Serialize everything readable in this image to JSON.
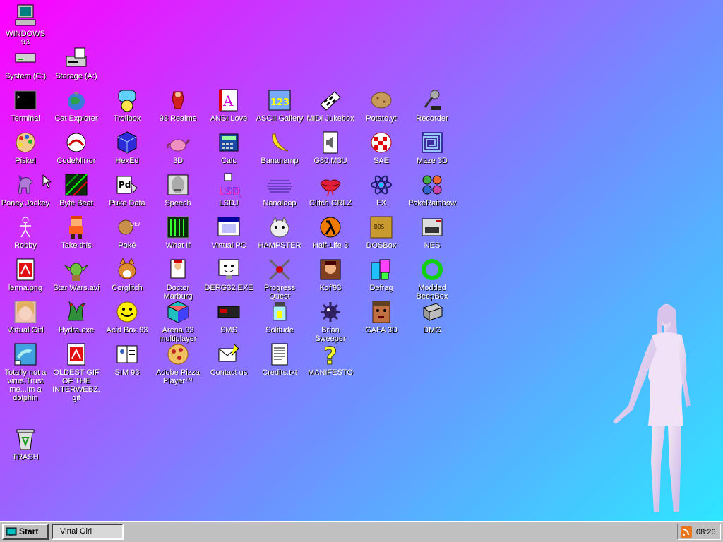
{
  "desktop": {
    "icons": [
      {
        "label": "WINDOWS 93",
        "icon": "computer-icon"
      },
      {
        "label": "System (C:)",
        "icon": "hard-drive-icon"
      },
      {
        "label": "Storage (A:)",
        "icon": "floppy-drive-icon"
      },
      {
        "label": "Terminal",
        "icon": "terminal-icon"
      },
      {
        "label": "Cat Explorer",
        "icon": "cat-globe-icon"
      },
      {
        "label": "Trollbox",
        "icon": "chat-bubble-icon"
      },
      {
        "label": "93 Realms",
        "icon": "warrior-icon"
      },
      {
        "label": "ANSI Love",
        "icon": "ansi-letter-icon"
      },
      {
        "label": "ASCII Gallery",
        "icon": "ascii-123-icon"
      },
      {
        "label": "MIDI Jukebox",
        "icon": "piano-icon"
      },
      {
        "label": "Potato.yt",
        "icon": "potato-icon"
      },
      {
        "label": "Recorder",
        "icon": "microphone-icon"
      },
      {
        "label": "Piskel",
        "icon": "palette-icon"
      },
      {
        "label": "CodeMirror",
        "icon": "codemirror-icon"
      },
      {
        "label": "HexEd",
        "icon": "cube-icon"
      },
      {
        "label": "3D",
        "icon": "teapot-icon"
      },
      {
        "label": "Calc",
        "icon": "calculator-icon"
      },
      {
        "label": "Bananamp",
        "icon": "banana-icon"
      },
      {
        "label": "G80.M3U",
        "icon": "audio-file-icon"
      },
      {
        "label": "SAE",
        "icon": "checker-ball-icon"
      },
      {
        "label": "Maze 3D",
        "icon": "maze-icon"
      },
      {
        "label": "Poney Jockey",
        "icon": "pony-icon"
      },
      {
        "label": "Byte Beat",
        "icon": "bytebeat-icon"
      },
      {
        "label": "Puke Data",
        "icon": "puke-data-icon"
      },
      {
        "label": "Speech",
        "icon": "speech-face-icon"
      },
      {
        "label": "LSDJ",
        "icon": "lsdj-icon"
      },
      {
        "label": "Nanoloop",
        "icon": "wave-icon"
      },
      {
        "label": "Glitch GRLZ",
        "icon": "lips-icon"
      },
      {
        "label": "FX",
        "icon": "atom-icon"
      },
      {
        "label": "PokéRainbow",
        "icon": "pokerainbow-icon"
      },
      {
        "label": "Robby",
        "icon": "stick-figure-icon"
      },
      {
        "label": "Take this",
        "icon": "pixel-character-icon"
      },
      {
        "label": "Poké",
        "icon": "pokedex-icon"
      },
      {
        "label": "What If",
        "icon": "matrix-icon"
      },
      {
        "label": "Virtual PC",
        "icon": "window-icon"
      },
      {
        "label": "HAMPSTER",
        "icon": "hamster-icon"
      },
      {
        "label": "Half-Life 3",
        "icon": "lambda-icon"
      },
      {
        "label": "DOSBox",
        "icon": "dosbox-icon"
      },
      {
        "label": "NES",
        "icon": "nes-console-icon"
      },
      {
        "label": "lenna.png",
        "icon": "image-file-icon"
      },
      {
        "label": "Star Wars.avi",
        "icon": "yoda-icon"
      },
      {
        "label": "Corglitch",
        "icon": "corgi-icon"
      },
      {
        "label": "Doctor Marburg",
        "icon": "doctor-icon"
      },
      {
        "label": "DERG32.EXE",
        "icon": "monitor-face-icon"
      },
      {
        "label": "Progress Quest",
        "icon": "swords-icon"
      },
      {
        "label": "Kof'93",
        "icon": "fighter-icon"
      },
      {
        "label": "Defrag",
        "icon": "defrag-icon"
      },
      {
        "label": "Modded BeepBox",
        "icon": "green-ring-icon"
      },
      {
        "label": "Virtual Girl",
        "icon": "girl-face-icon"
      },
      {
        "label": "Hydra.exe",
        "icon": "hydra-icon"
      },
      {
        "label": "Acid Box 93",
        "icon": "smiley-icon"
      },
      {
        "label": "Arena 93 multiplayer",
        "icon": "arena-cube-icon"
      },
      {
        "label": "SMS",
        "icon": "sms-console-icon"
      },
      {
        "label": "Solitude",
        "icon": "lantern-icon"
      },
      {
        "label": "Brian Sweeper",
        "icon": "mine-icon"
      },
      {
        "label": "GAFA 3D",
        "icon": "doomguy-icon"
      },
      {
        "label": "DMG",
        "icon": "gameboy-icon"
      },
      {
        "label": "Totally not a virus.Trust me...im a dolphin",
        "icon": "dolphin-icon"
      },
      {
        "label": "OLDEST GIF OF THE INTERWEBZ.gif",
        "icon": "gif-file-icon"
      },
      {
        "label": "SIM 93",
        "icon": "sim-book-icon"
      },
      {
        "label": "Adobe Pizza Player™",
        "icon": "pizza-icon"
      },
      {
        "label": "Contact us",
        "icon": "contact-icon"
      },
      {
        "label": "Credits.txt",
        "icon": "text-file-icon"
      },
      {
        "label": "MANIFESTO",
        "icon": "question-mark-icon"
      },
      {
        "label": "TRASH",
        "icon": "recycle-bin-icon"
      }
    ]
  },
  "taskbar": {
    "start_label": "Start",
    "task_label": "Virtal Girl",
    "clock": "08:26"
  }
}
